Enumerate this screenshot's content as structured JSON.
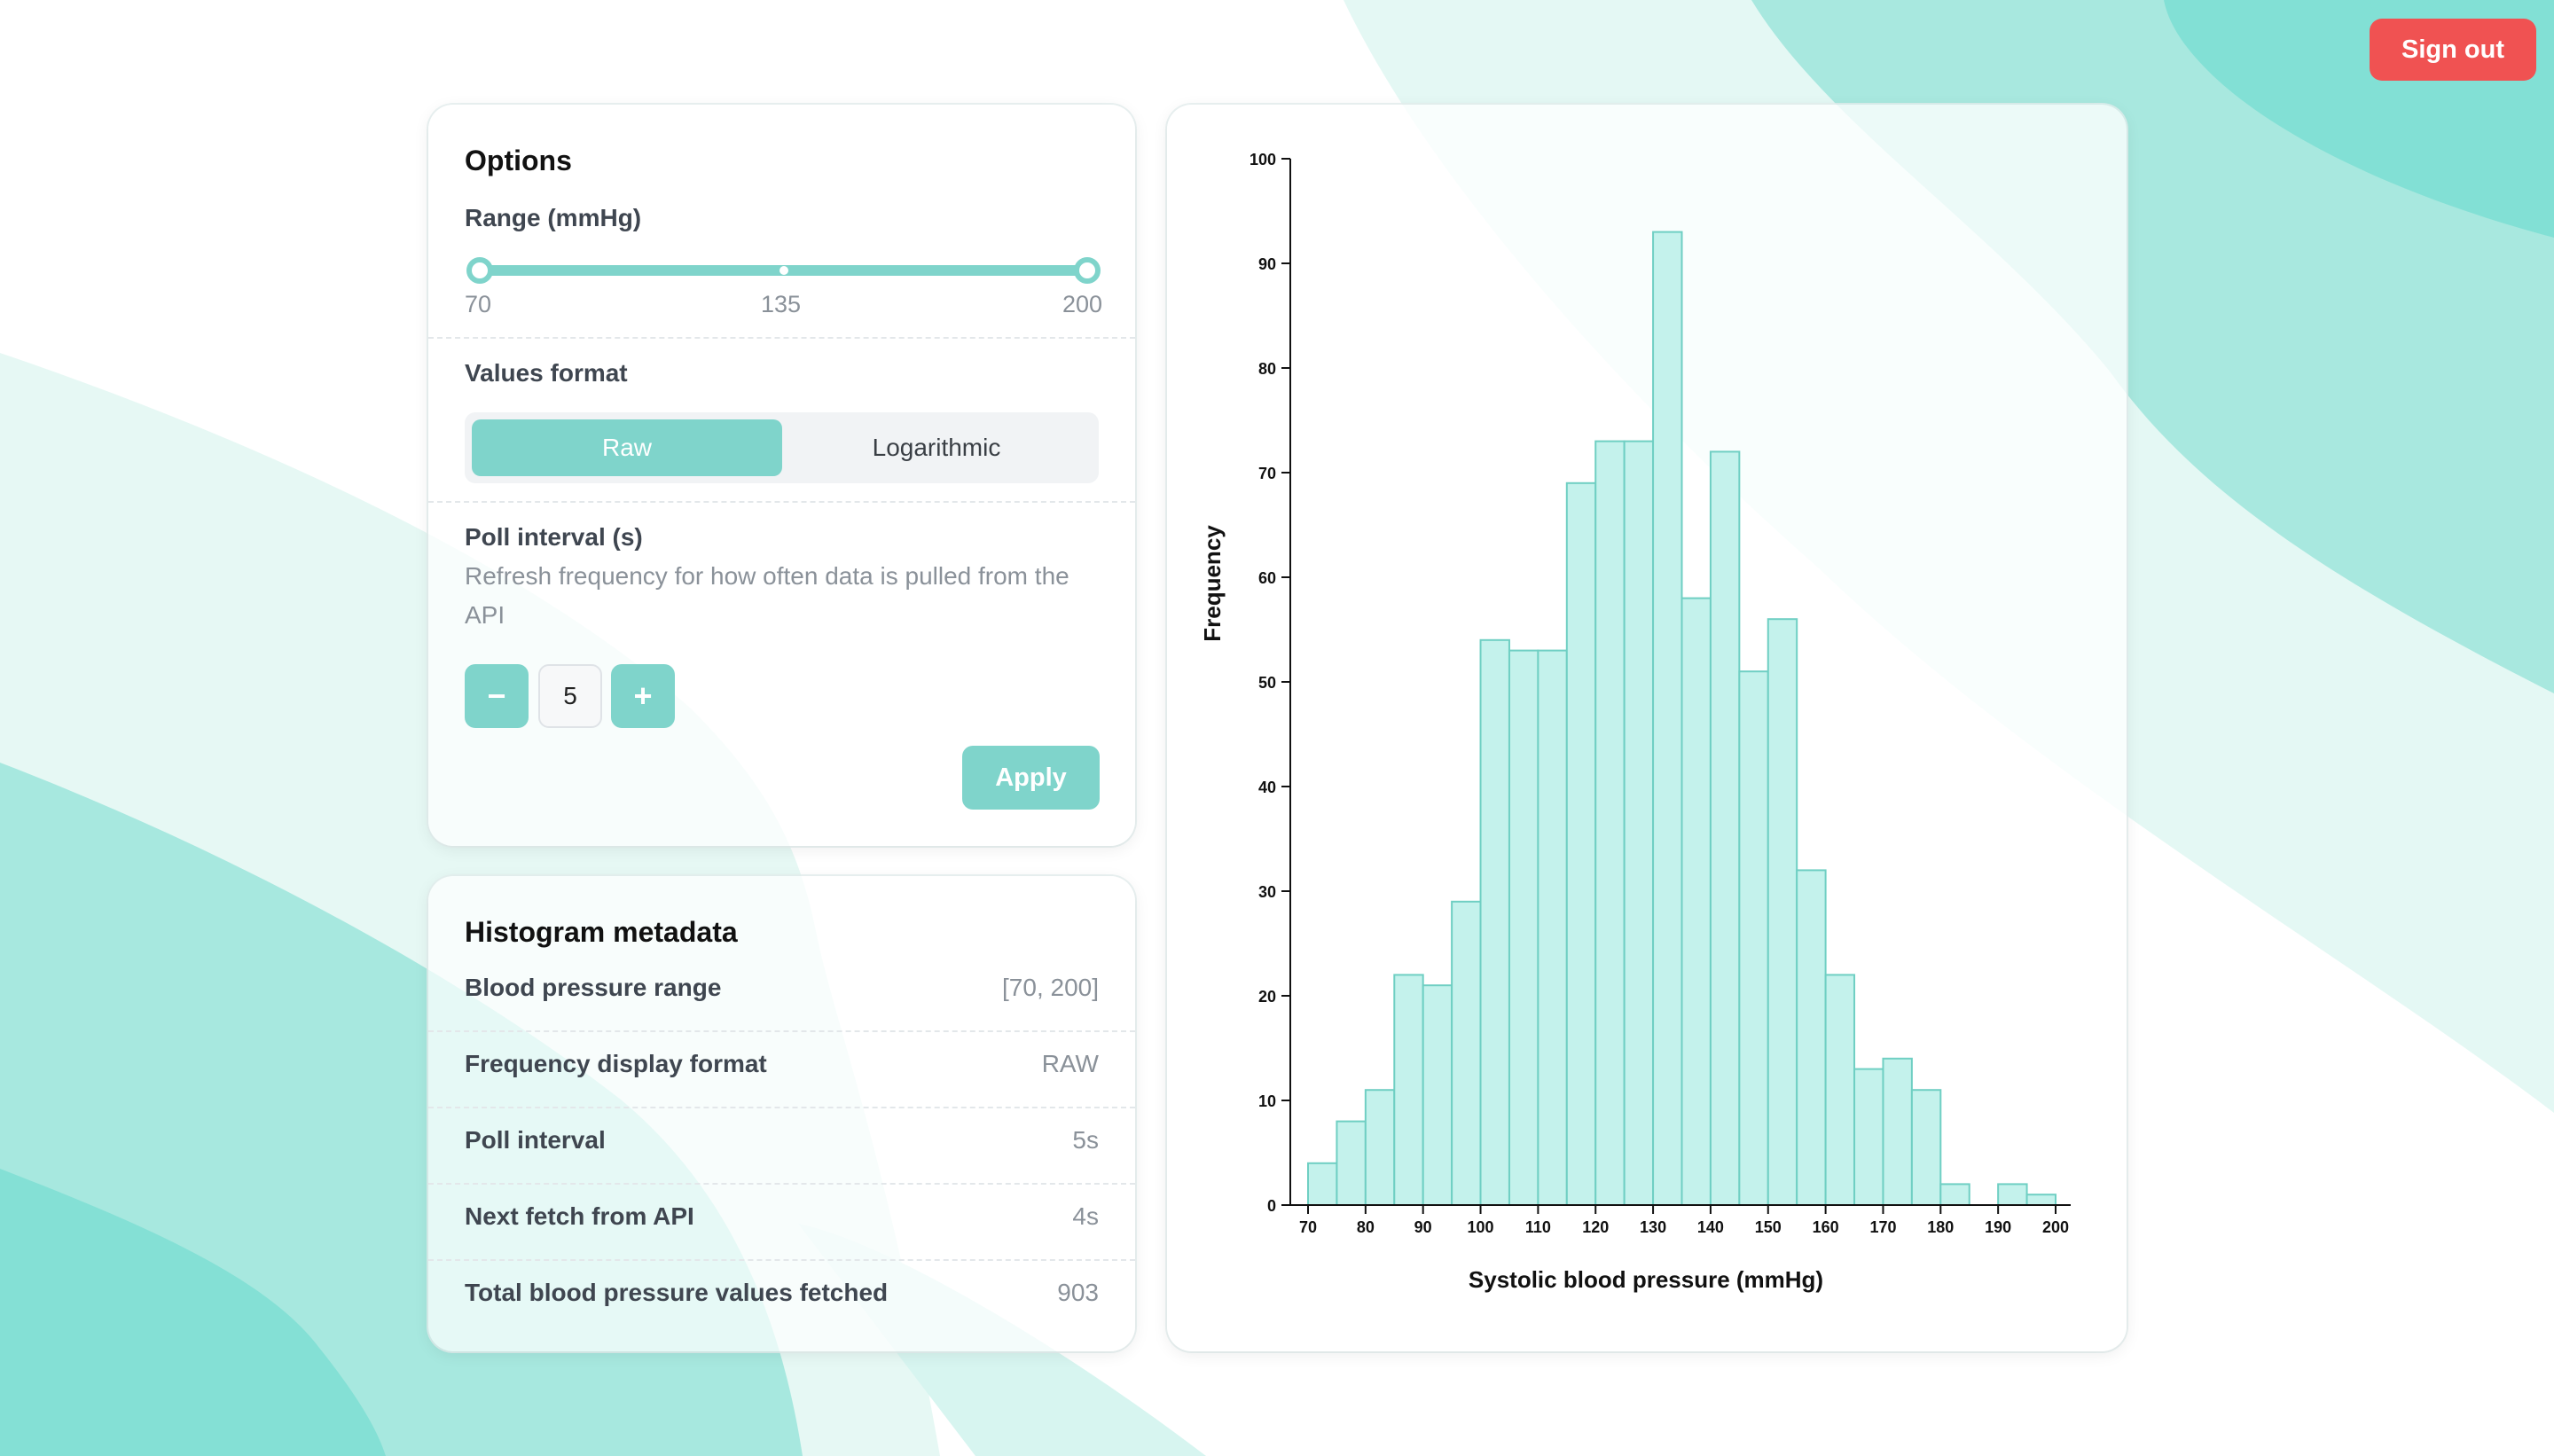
{
  "header": {
    "sign_out_label": "Sign out"
  },
  "options": {
    "title": "Options",
    "range_label": "Range (mmHg)",
    "range_min_label": "70",
    "range_mid_label": "135",
    "range_max_label": "200",
    "values_format_label": "Values format",
    "format_options": [
      "Raw",
      "Logarithmic"
    ],
    "format_selected": "Raw",
    "poll_label": "Poll interval (s)",
    "poll_help": "Refresh frequency for how often data is pulled from the API",
    "poll_value": "5",
    "minus_label": "−",
    "plus_label": "+",
    "apply_label": "Apply"
  },
  "metadata": {
    "title": "Histogram metadata",
    "rows": [
      {
        "key": "Blood pressure range",
        "value": "[70, 200]"
      },
      {
        "key": "Frequency display format",
        "value": "RAW"
      },
      {
        "key": "Poll interval",
        "value": "5s"
      },
      {
        "key": "Next fetch from API",
        "value": "4s"
      },
      {
        "key": "Total blood pressure values fetched",
        "value": "903"
      }
    ]
  },
  "colors": {
    "accent": "#7fd4cb",
    "bar_fill": "#c4f2ec",
    "bar_stroke": "#6fcfc3",
    "danger": "#f05252"
  },
  "chart_data": {
    "type": "bar",
    "xlabel": "Systolic blood pressure (mmHg)",
    "ylabel": "Frequency",
    "xlim": [
      70,
      200
    ],
    "ylim": [
      0,
      100
    ],
    "x_ticks": [
      70,
      80,
      90,
      100,
      110,
      120,
      130,
      140,
      150,
      160,
      170,
      180,
      190,
      200
    ],
    "y_ticks": [
      0,
      10,
      20,
      30,
      40,
      50,
      60,
      70,
      80,
      90,
      100
    ],
    "bin_width": 5,
    "bins": [
      {
        "start": 70,
        "end": 75,
        "value": 4
      },
      {
        "start": 75,
        "end": 80,
        "value": 8
      },
      {
        "start": 80,
        "end": 85,
        "value": 11
      },
      {
        "start": 85,
        "end": 90,
        "value": 22
      },
      {
        "start": 90,
        "end": 95,
        "value": 21
      },
      {
        "start": 95,
        "end": 100,
        "value": 29
      },
      {
        "start": 100,
        "end": 105,
        "value": 54
      },
      {
        "start": 105,
        "end": 110,
        "value": 53
      },
      {
        "start": 110,
        "end": 115,
        "value": 53
      },
      {
        "start": 115,
        "end": 120,
        "value": 69
      },
      {
        "start": 120,
        "end": 125,
        "value": 73
      },
      {
        "start": 125,
        "end": 130,
        "value": 73
      },
      {
        "start": 130,
        "end": 135,
        "value": 93
      },
      {
        "start": 135,
        "end": 140,
        "value": 58
      },
      {
        "start": 140,
        "end": 145,
        "value": 72
      },
      {
        "start": 145,
        "end": 150,
        "value": 51
      },
      {
        "start": 150,
        "end": 155,
        "value": 56
      },
      {
        "start": 155,
        "end": 160,
        "value": 32
      },
      {
        "start": 160,
        "end": 165,
        "value": 22
      },
      {
        "start": 165,
        "end": 170,
        "value": 13
      },
      {
        "start": 170,
        "end": 175,
        "value": 14
      },
      {
        "start": 175,
        "end": 180,
        "value": 11
      },
      {
        "start": 180,
        "end": 185,
        "value": 2
      },
      {
        "start": 185,
        "end": 190,
        "value": 0
      },
      {
        "start": 190,
        "end": 195,
        "value": 2
      },
      {
        "start": 195,
        "end": 200,
        "value": 1
      }
    ],
    "grid": false,
    "legend": "none"
  }
}
